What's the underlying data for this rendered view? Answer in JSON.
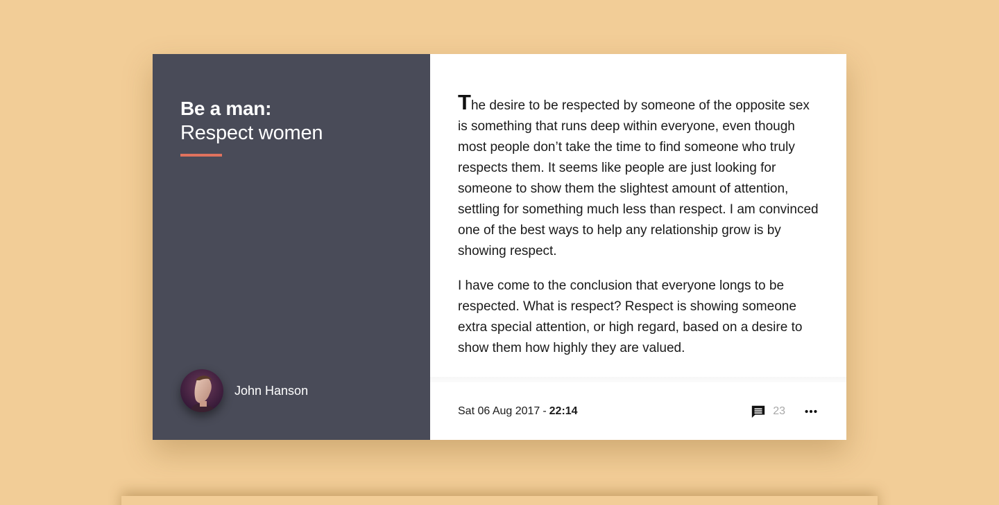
{
  "card": {
    "title_bold": "Be a man:",
    "title_light": "Respect women",
    "author": {
      "name": "John Hanson",
      "avatar_icon": "avatar-photo"
    },
    "article": {
      "dropcap": "T",
      "paragraph1_rest": "he desire to be respected by someone of the opposite sex is something that runs deep within everyone, even though most people don’t take the time to find someone who truly respects them. It seems like people are just looking for someone to show them the slightest amount of attention, settling for something much less than respect. I am convinced one of the best ways to help any relationship grow is by showing respect.",
      "paragraph2": "I have come to the conclusion that everyone longs to be respected. What is respect? Respect is showing someone extra special attention, or high regard, based on a desire to show them how highly they are valued."
    },
    "footer": {
      "date": "Sat 06 Aug 2017",
      "separator": "-",
      "time": "22:14",
      "comment_count": "23",
      "comment_icon": "comment-icon",
      "more_icon": "more-horizontal-icon"
    }
  },
  "colors": {
    "background": "#f2cd97",
    "left_panel": "#494b58",
    "accent": "#e0725e",
    "text": "#1a1a1a",
    "muted": "#a8a8a8"
  }
}
